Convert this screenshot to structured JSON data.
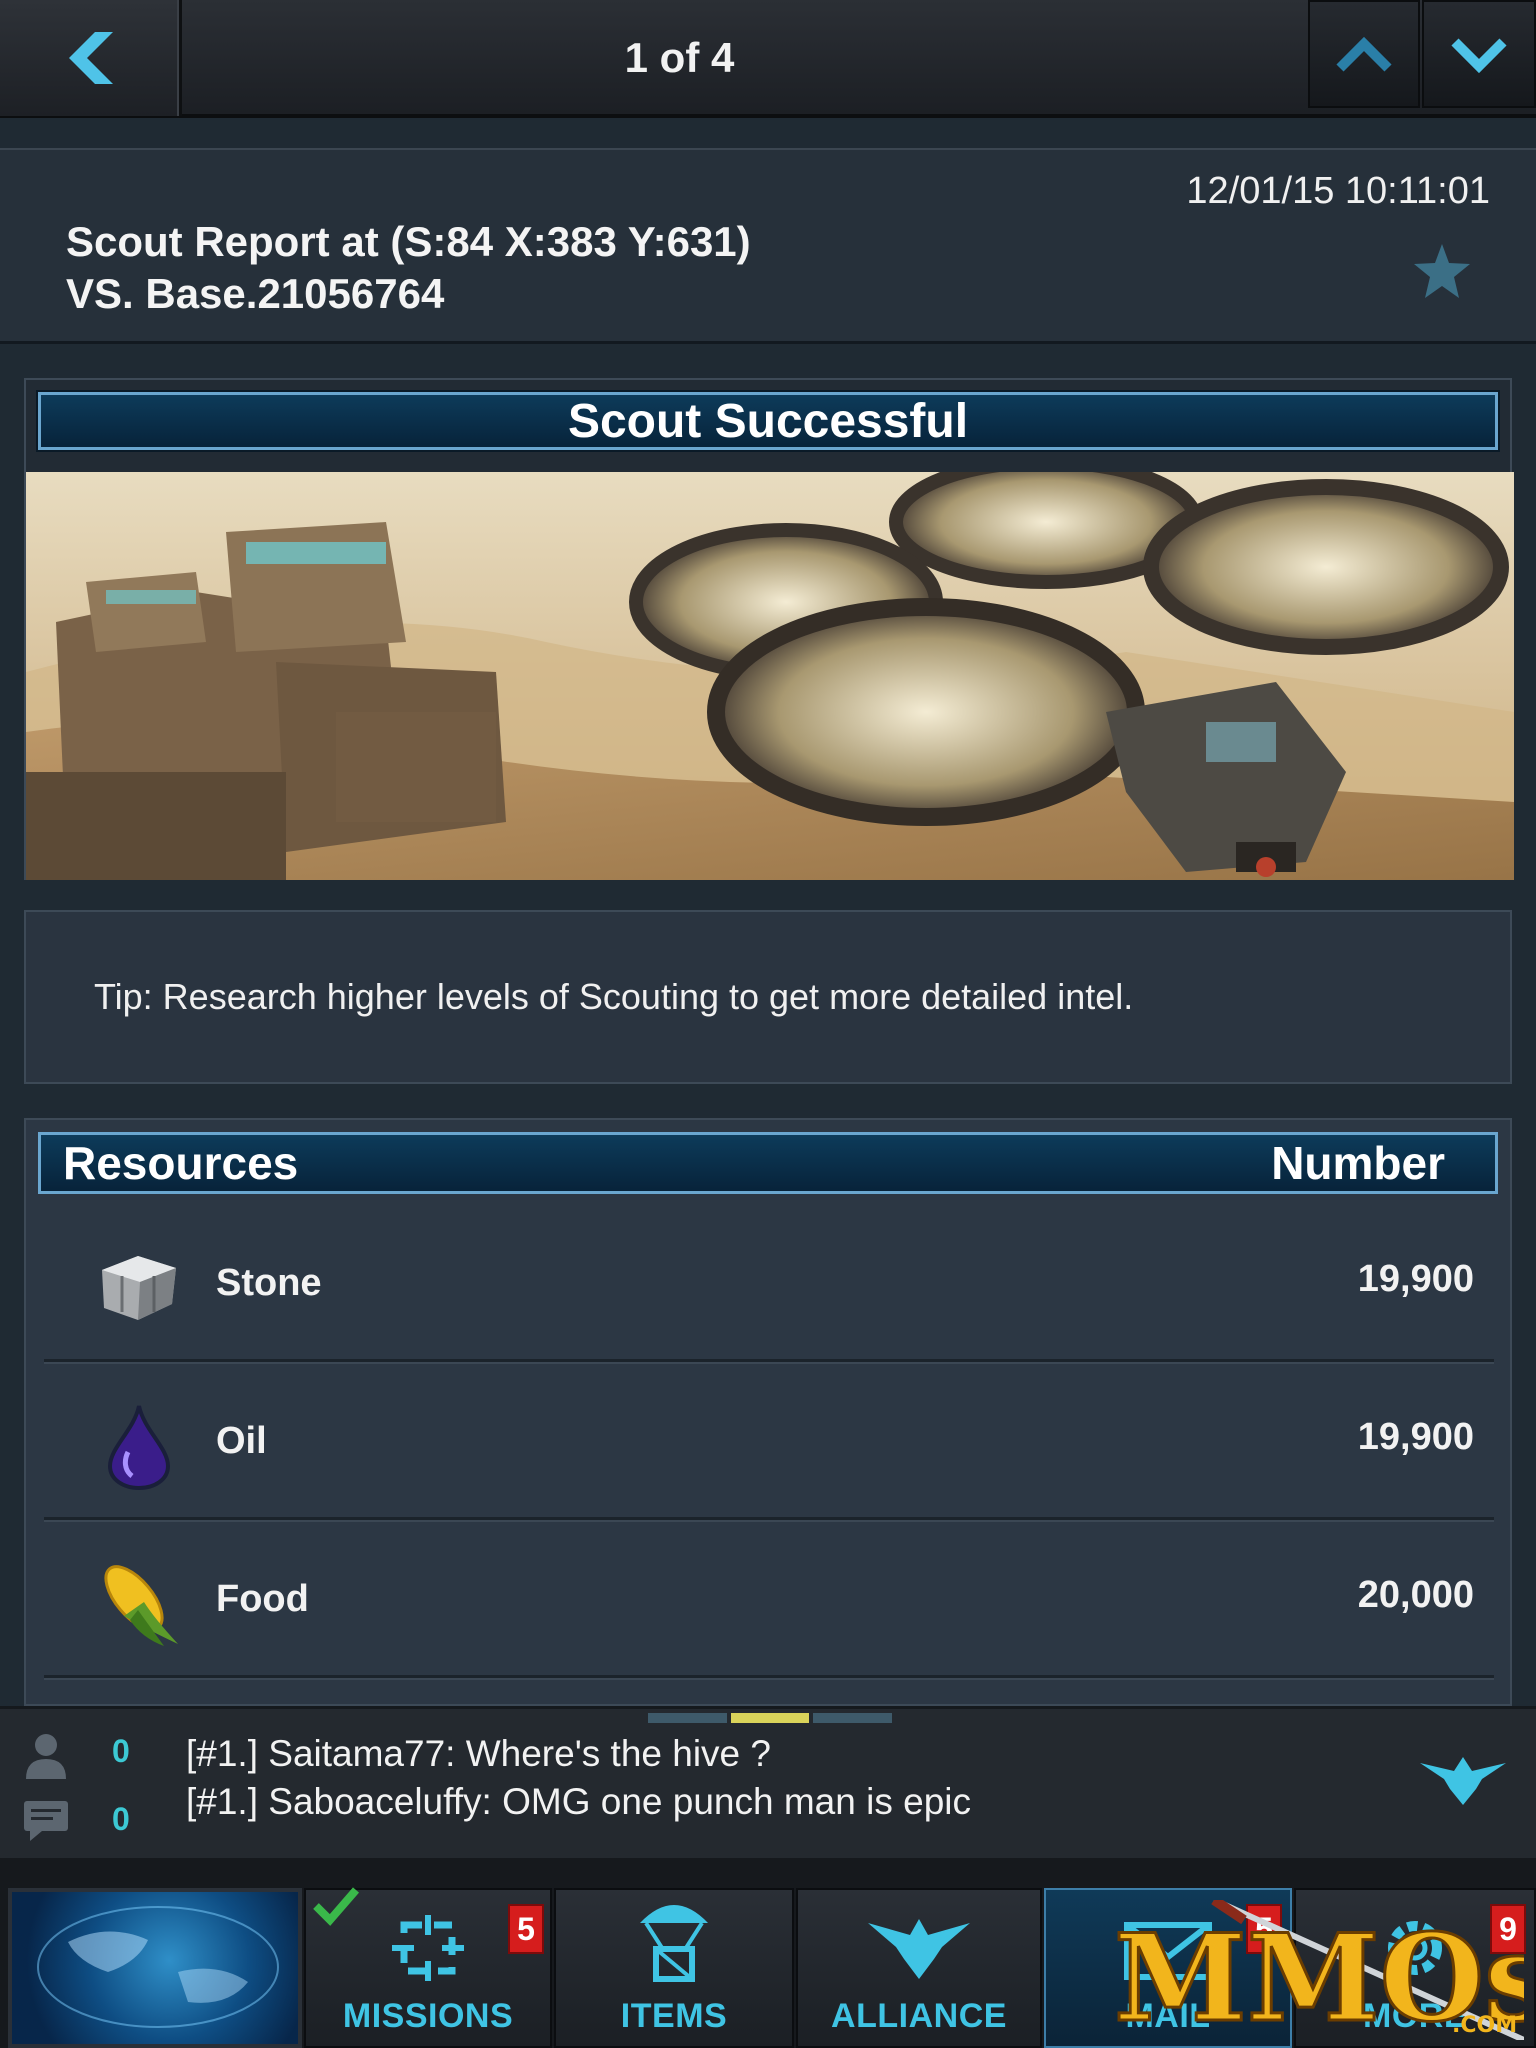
{
  "topbar": {
    "pager_text": "1 of 4"
  },
  "report": {
    "date": "12/01/15 10:11:01",
    "title_line1": "Scout Report at (S:84 X:383 Y:631)",
    "title_line2": "VS. Base.21056764"
  },
  "scout": {
    "banner_title": "Scout Successful",
    "tip": "Tip: Research higher levels of Scouting to get more detailed intel."
  },
  "resources": {
    "header_left": "Resources",
    "header_right": "Number",
    "rows": [
      {
        "name": "Stone",
        "value": "19,900",
        "icon": "stone-icon"
      },
      {
        "name": "Oil",
        "value": "19,900",
        "icon": "oil-drop-icon"
      },
      {
        "name": "Food",
        "value": "20,000",
        "icon": "corn-icon"
      }
    ]
  },
  "chat": {
    "player_count": "0",
    "message_count": "0",
    "messages": [
      "[#1.] Saitama77:  Where's the hive ?",
      "[#1.] Saboaceluffy: OMG one punch man is epic"
    ]
  },
  "tabs": {
    "missions": {
      "label": "MISSIONS",
      "badge": "5"
    },
    "items": {
      "label": "ITEMS"
    },
    "alliance": {
      "label": "ALLIANCE"
    },
    "mail": {
      "label": "MAIL",
      "badge": "5"
    },
    "more": {
      "label": "MORE",
      "badge": "9"
    }
  },
  "watermark": {
    "text": "MMOs",
    "suffix": ".COM"
  },
  "colors": {
    "accent_cyan": "#3fc4e4",
    "banner_blue": "#0d3b5a",
    "badge_red": "#d61d1d",
    "chat_count": "#3cc9d4"
  }
}
